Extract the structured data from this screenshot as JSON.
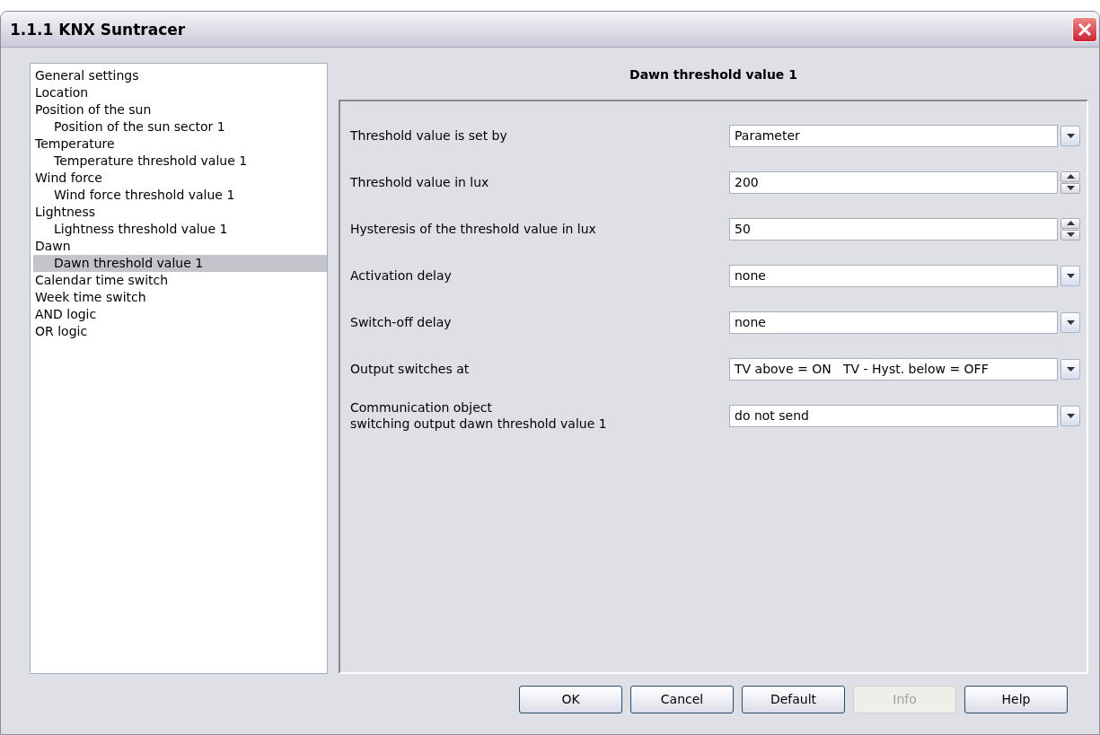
{
  "window": {
    "title": "1.1.1 KNX Suntracer"
  },
  "sidebar": {
    "items": [
      {
        "label": "General settings",
        "selected": false
      },
      {
        "label": "Location",
        "selected": false
      },
      {
        "label": "Position of the sun",
        "selected": false,
        "children": [
          {
            "label": "Position of the sun sector 1",
            "selected": false
          }
        ]
      },
      {
        "label": "Temperature",
        "selected": false,
        "children": [
          {
            "label": "Temperature threshold value 1",
            "selected": false
          }
        ]
      },
      {
        "label": "Wind force",
        "selected": false,
        "children": [
          {
            "label": "Wind force threshold value 1",
            "selected": false
          }
        ]
      },
      {
        "label": "Lightness",
        "selected": false,
        "children": [
          {
            "label": "Lightness threshold value 1",
            "selected": false
          }
        ]
      },
      {
        "label": "Dawn",
        "selected": false,
        "children": [
          {
            "label": "Dawn threshold value 1",
            "selected": true
          }
        ]
      },
      {
        "label": "Calendar time switch",
        "selected": false
      },
      {
        "label": "Week time switch",
        "selected": false
      },
      {
        "label": "AND logic",
        "selected": false
      },
      {
        "label": "OR logic",
        "selected": false
      }
    ]
  },
  "panel": {
    "title": "Dawn threshold value 1",
    "rows": [
      {
        "kind": "select",
        "label": "Threshold value is set by",
        "value": "Parameter"
      },
      {
        "kind": "spin",
        "label": "Threshold value in lux",
        "value": "200"
      },
      {
        "kind": "spin",
        "label": "Hysteresis of the threshold value in lux",
        "value": "50"
      },
      {
        "kind": "select",
        "label": "Activation delay",
        "value": "none"
      },
      {
        "kind": "select",
        "label": "Switch-off delay",
        "value": "none"
      },
      {
        "kind": "select",
        "label": "Output switches at",
        "value": "TV above = ON   TV - Hyst. below = OFF"
      },
      {
        "kind": "select",
        "label": "Communication object\nswitching output dawn threshold value 1",
        "value": "do not send"
      }
    ]
  },
  "buttons": [
    {
      "label": "OK",
      "disabled": false
    },
    {
      "label": "Cancel",
      "disabled": false
    },
    {
      "label": "Default",
      "disabled": false
    },
    {
      "label": "Info",
      "disabled": true
    },
    {
      "label": "Help",
      "disabled": false
    }
  ]
}
